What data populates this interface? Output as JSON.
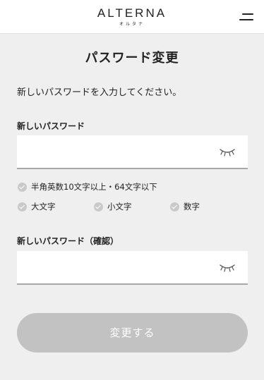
{
  "header": {
    "logo": "ALTERNA",
    "logo_sub": "オルタナ",
    "menu_icon": "hamburger-menu-icon"
  },
  "page": {
    "title": "パスワード変更",
    "instruction": "新しいパスワードを入力してください。"
  },
  "new_password": {
    "label": "新しいパスワード",
    "value": "",
    "toggle_icon": "eye-closed-icon"
  },
  "rules": {
    "length": "半角英数10文字以上・64文字以下",
    "uppercase": "大文字",
    "lowercase": "小文字",
    "digit": "数字",
    "icon": "check-circle-icon"
  },
  "confirm_password": {
    "label": "新しいパスワード（確認）",
    "value": "",
    "toggle_icon": "eye-closed-icon"
  },
  "submit": {
    "label": "変更する",
    "color": "#c2c2c2"
  }
}
